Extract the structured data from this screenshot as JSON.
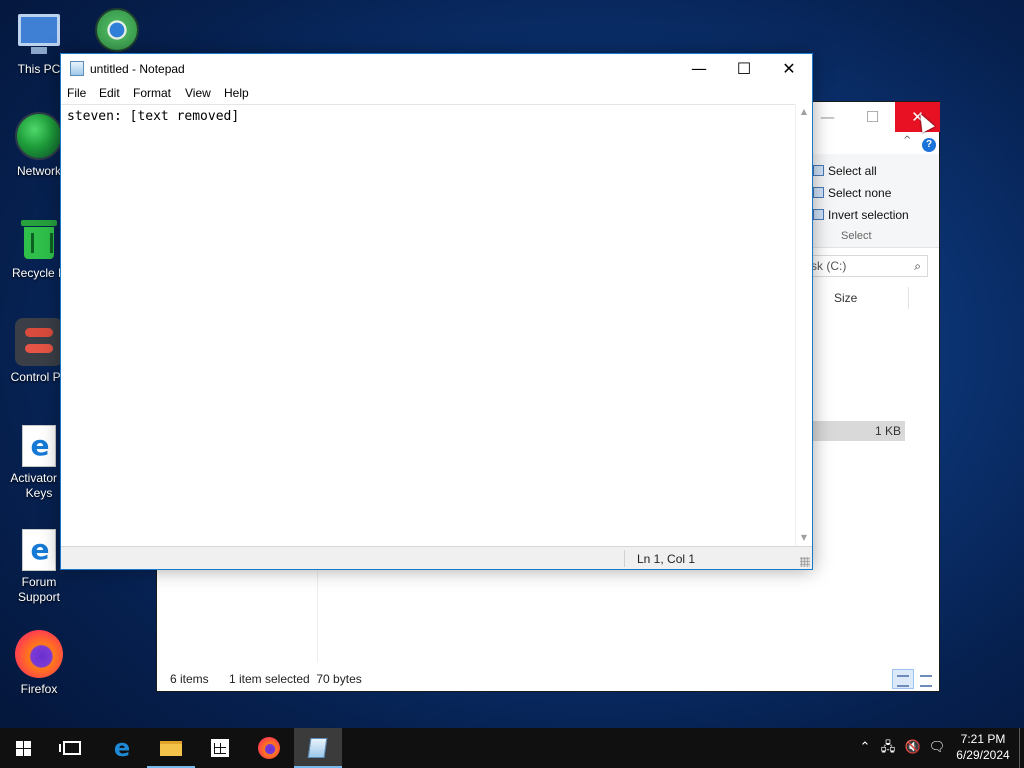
{
  "desktop": {
    "icons": [
      {
        "label": "This PC",
        "icon": "this-pc-icon"
      },
      {
        "label": "",
        "icon": "browser-globe-icon"
      },
      {
        "label": "Network",
        "icon": "network-icon"
      },
      {
        "label": "Recycle B",
        "icon": "recycle-bin-icon"
      },
      {
        "label": "Control Pa",
        "icon": "control-panel-icon"
      },
      {
        "label": "Activator A\nKeys",
        "icon": "document-shortcut-icon"
      },
      {
        "label": "Forum\nSupport",
        "icon": "document-shortcut-icon"
      },
      {
        "label": "Firefox",
        "icon": "firefox-icon"
      }
    ]
  },
  "notepad": {
    "title": "untitled - Notepad",
    "menu": [
      "File",
      "Edit",
      "Format",
      "View",
      "Help"
    ],
    "content": "steven: [text removed]",
    "status_position": "Ln 1, Col 1",
    "controls": {
      "minimize": "—",
      "maximize": "☐",
      "close": "✕"
    }
  },
  "explorer": {
    "controls": {
      "minimize": "—",
      "maximize": "☐",
      "close": "✕"
    },
    "help": "?",
    "ribbon": {
      "select_all": "Select all",
      "select_none": "Select none",
      "invert_selection": "Invert selection",
      "group_label": "Select"
    },
    "search_placeholder": "sk (C:)",
    "column_size": "Size",
    "selected_row_size": "1 KB",
    "status": {
      "item_count": "6 items",
      "selection": "1 item selected  70 bytes"
    }
  },
  "taskbar": {
    "items": [
      "start-button",
      "task-view-button",
      "edge-button",
      "file-explorer-button",
      "store-button",
      "firefox-button",
      "notepad-button"
    ],
    "active_item": "notepad-button",
    "tray": {
      "time": "7:21 PM",
      "date": "6/29/2024"
    }
  },
  "colors": {
    "accent": "#1979ca",
    "close_red": "#e81123",
    "taskbar_bg": "#101010"
  }
}
